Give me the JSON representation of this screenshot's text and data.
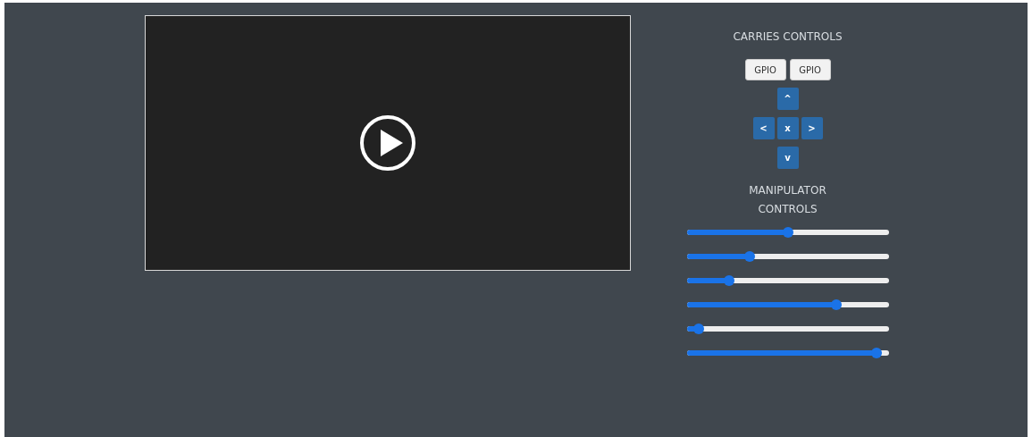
{
  "video": {
    "kind": "video"
  },
  "carries_controls": {
    "title": "CARRIES CONTROLS",
    "gpio_buttons": [
      "GPIO",
      "GPIO"
    ],
    "direction_buttons": {
      "up": "^",
      "left": "<",
      "stop": "x",
      "right": ">",
      "down": "v"
    }
  },
  "manipulator_controls": {
    "title": "MANIPULATOR CONTROLS",
    "sliders": [
      {
        "level": 0.5
      },
      {
        "level": 0.31
      },
      {
        "level": 0.21
      },
      {
        "level": 0.74
      },
      {
        "level": 0.06
      },
      {
        "level": 0.94
      }
    ]
  }
}
